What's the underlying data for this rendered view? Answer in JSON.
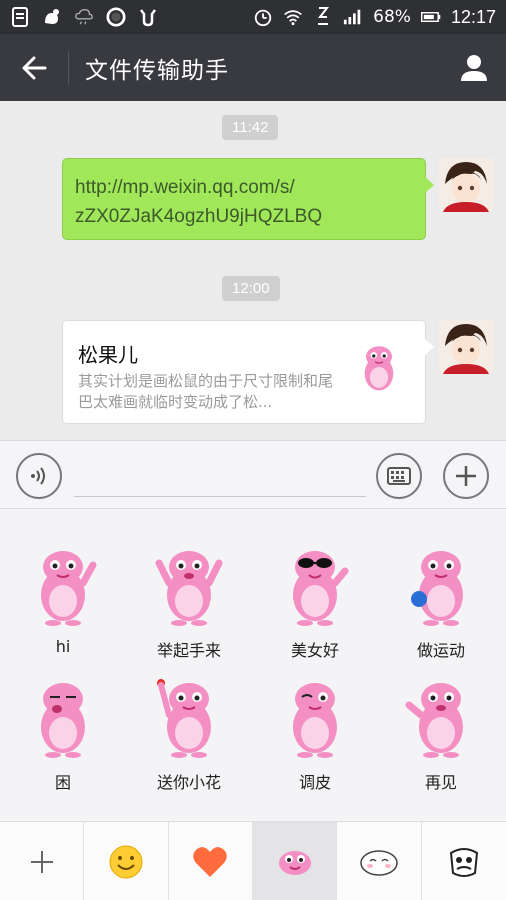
{
  "status_bar": {
    "battery": "68%",
    "time": "12:17"
  },
  "header": {
    "title": "文件传输助手"
  },
  "messages": [
    {
      "time": "11:42",
      "type": "link",
      "text_line1": "http://mp.weixin.qq.com/s/",
      "text_line2": "zZX0ZJaK4ogzhU9jHQZLBQ"
    },
    {
      "time": "12:00",
      "type": "card",
      "title": "松果儿",
      "description": "其实计划是画松鼠的由于尺寸限制和尾巴太难画就临时变动成了松..."
    }
  ],
  "input": {
    "placeholder": ""
  },
  "stickers": [
    {
      "label": "hi"
    },
    {
      "label": "举起手来"
    },
    {
      "label": "美女好"
    },
    {
      "label": "做运动"
    },
    {
      "label": "困"
    },
    {
      "label": "送你小花"
    },
    {
      "label": "调皮"
    },
    {
      "label": "再见"
    }
  ],
  "colors": {
    "header": "#393a3f",
    "status_bar": "#2f3033",
    "link_bubble": "#a0e75a",
    "sticker_pink": "#f48fc4"
  },
  "icons": {
    "back": "arrow-left-icon",
    "profile": "person-icon",
    "voice": "voice-icon",
    "keyboard": "keyboard-icon",
    "more": "plus-icon",
    "emoji_smile": "smile-icon",
    "heart": "heart-icon"
  }
}
